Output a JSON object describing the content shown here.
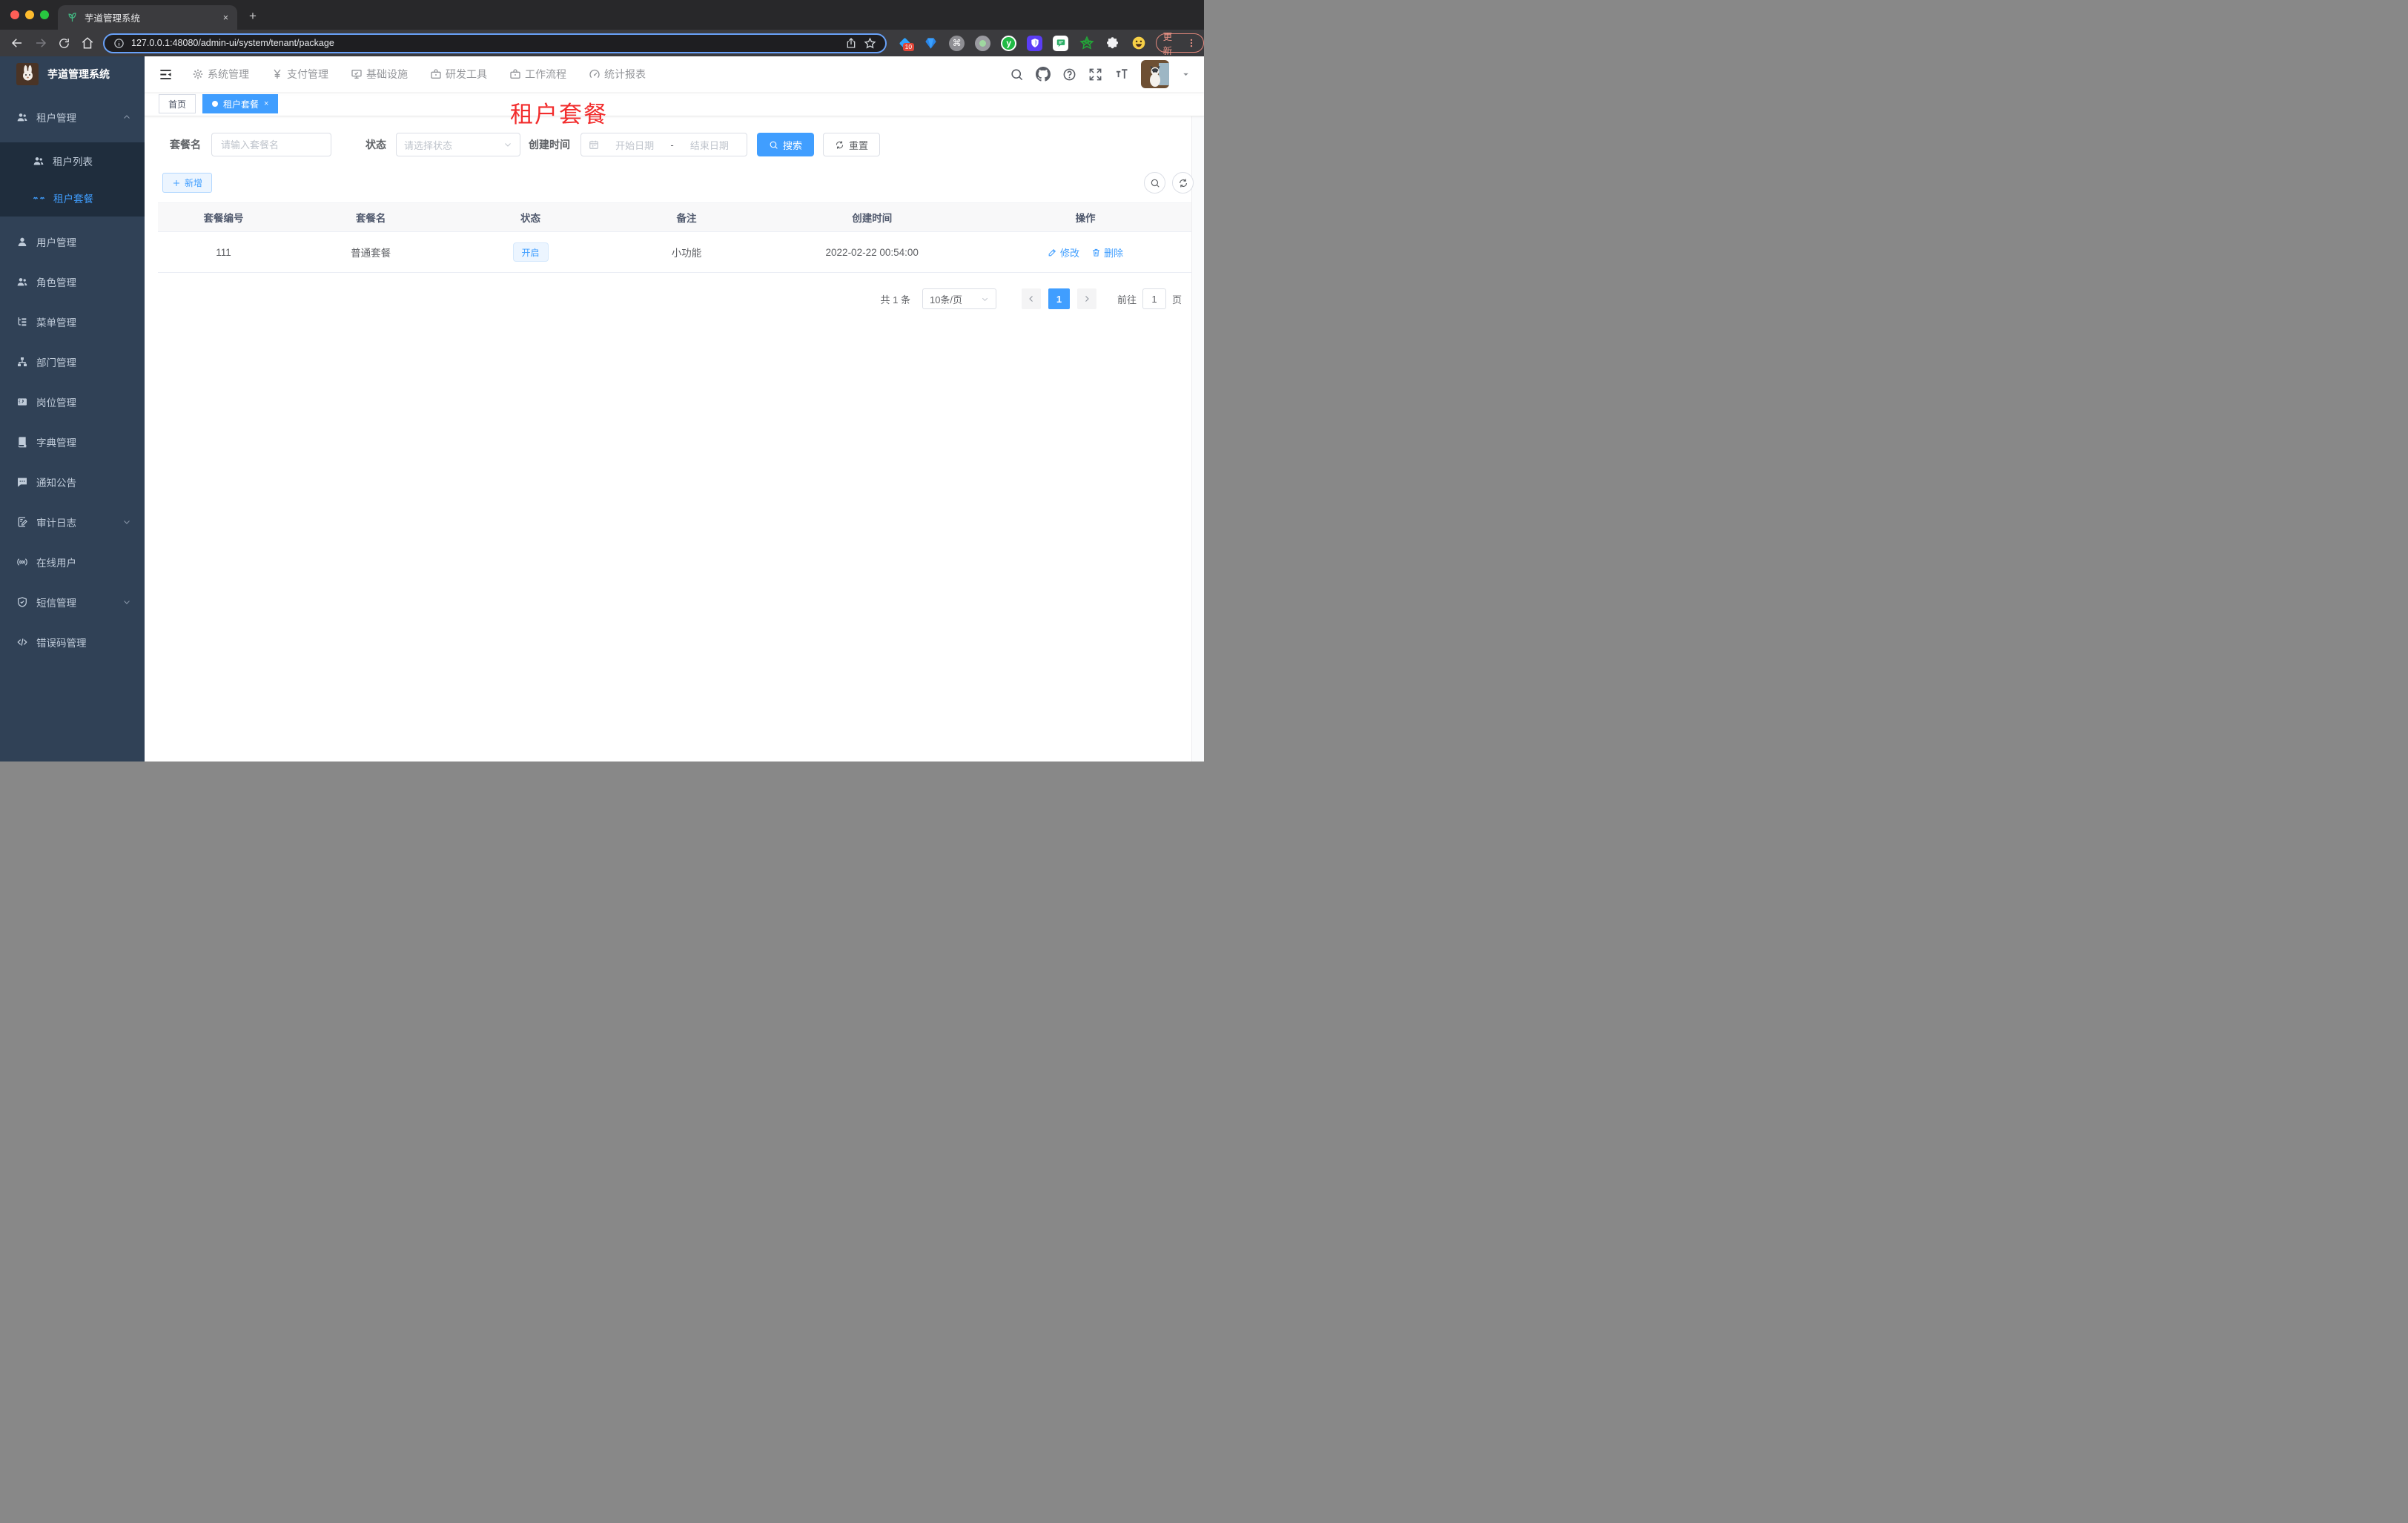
{
  "browser": {
    "tab_title": "芋道管理系统",
    "tab_close": "×",
    "new_tab": "+",
    "url": "127.0.0.1:48080/admin-ui/system/tenant/package",
    "extension_badge": "10",
    "ext_cmd_glyph": "⌘",
    "ext_y_glyph": "y",
    "update_label": "更新",
    "traffic_colors": {
      "close": "#ff5f57",
      "min": "#febc2e",
      "max": "#28c840"
    }
  },
  "sidebar": {
    "app_title": "芋道管理系统",
    "items": [
      {
        "label": "租户管理",
        "icon": "users-icon",
        "caret": "up"
      },
      {
        "label": "租户列表",
        "icon": "users-icon"
      },
      {
        "label": "租户套餐",
        "icon": "tenant-package-icon",
        "active": true
      },
      {
        "label": "用户管理",
        "icon": "user-icon"
      },
      {
        "label": "角色管理",
        "icon": "users-icon"
      },
      {
        "label": "菜单管理",
        "icon": "menu-tree-icon"
      },
      {
        "label": "部门管理",
        "icon": "org-chart-icon"
      },
      {
        "label": "岗位管理",
        "icon": "post-badge-icon"
      },
      {
        "label": "字典管理",
        "icon": "dictionary-icon"
      },
      {
        "label": "通知公告",
        "icon": "announcement-icon"
      },
      {
        "label": "审计日志",
        "icon": "audit-log-icon",
        "caret": "down"
      },
      {
        "label": "在线用户",
        "icon": "online-user-icon"
      },
      {
        "label": "短信管理",
        "icon": "sms-shield-icon",
        "caret": "down"
      },
      {
        "label": "错误码管理",
        "icon": "error-code-icon"
      }
    ]
  },
  "topnav": {
    "items": [
      {
        "label": "系统管理",
        "icon": "gear-icon"
      },
      {
        "label": "支付管理",
        "icon": "yen-icon"
      },
      {
        "label": "基础设施",
        "icon": "monitor-icon"
      },
      {
        "label": "研发工具",
        "icon": "toolbox-icon"
      },
      {
        "label": "工作流程",
        "icon": "workflow-case-icon"
      },
      {
        "label": "统计报表",
        "icon": "report-gauge-icon"
      }
    ]
  },
  "tags": {
    "home": "首页",
    "active": "租户套餐",
    "close": "×"
  },
  "page_title": "租户套餐",
  "filter": {
    "name_label": "套餐名",
    "name_placeholder": "请输入套餐名",
    "status_label": "状态",
    "status_placeholder": "请选择状态",
    "date_label": "创建时间",
    "date_start": "开始日期",
    "date_separator": "-",
    "date_end": "结束日期",
    "search_label": "搜索",
    "reset_label": "重置"
  },
  "toolbar": {
    "add_label": "新增"
  },
  "table": {
    "headers": [
      "套餐编号",
      "套餐名",
      "状态",
      "备注",
      "创建时间",
      "操作"
    ],
    "rows": [
      {
        "id": "111",
        "name": "普通套餐",
        "status": "开启",
        "remark": "小功能",
        "created": "2022-02-22 00:54:00",
        "edit_label": "修改",
        "delete_label": "删除"
      }
    ]
  },
  "pagination": {
    "total": "共 1 条",
    "page_size": "10条/页",
    "current_page": "1",
    "goto_label": "前往",
    "goto_value": "1",
    "unit_label": "页"
  },
  "colors": {
    "primary": "#409eff",
    "sidebar_bg": "#304156",
    "submenu_bg": "#1f2d3d",
    "title_red": "#f22c2c",
    "status_tag_bg": "#ecf5ff"
  }
}
